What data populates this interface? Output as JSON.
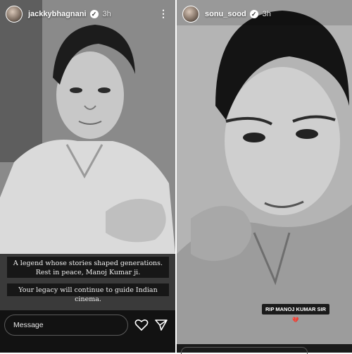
{
  "left_story": {
    "username": "jackkybhagnani",
    "timestamp": "3h",
    "caption_lines": [
      "A legend whose stories shaped generations. Rest in peace, Manoj Kumar ji.",
      "Your legacy will continue to guide Indian cinema."
    ],
    "message_placeholder": "Message",
    "icons": [
      "verified-badge-icon",
      "more-options-icon",
      "heart-icon",
      "send-icon"
    ]
  },
  "right_story": {
    "username": "sonu_sood",
    "timestamp": "3h",
    "sticker_text": "RIP MANOJ KUMAR SIR",
    "sticker_emoji": "💔",
    "icons": [
      "verified-badge-icon",
      "broken-heart-icon"
    ]
  },
  "colors": {
    "story_background": "#121212",
    "text_primary": "#ffffff",
    "caption_background": "#121212"
  }
}
